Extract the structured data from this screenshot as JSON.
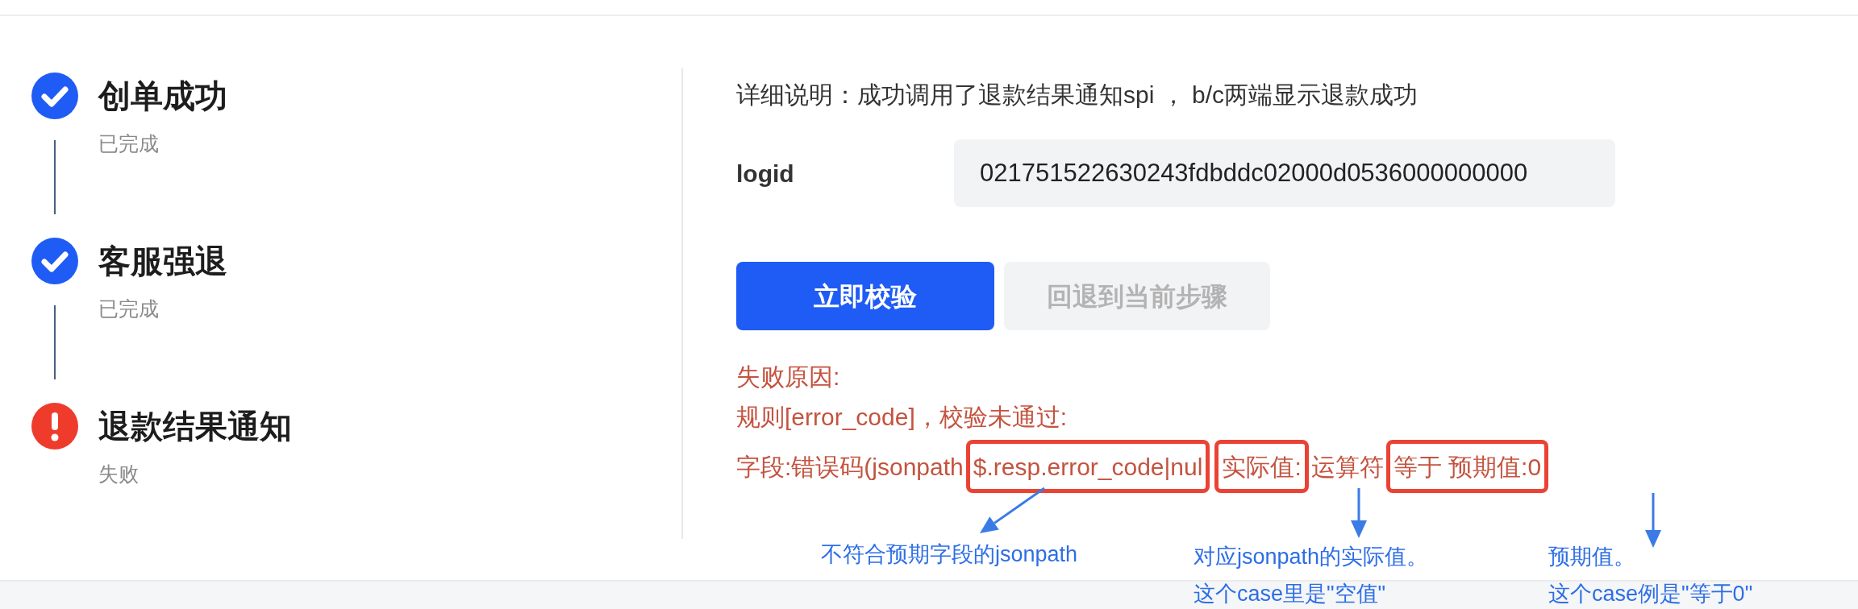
{
  "steps": [
    {
      "title": "创单成功",
      "status_text": "已完成",
      "kind": "done"
    },
    {
      "title": "客服强退",
      "status_text": "已完成",
      "kind": "done"
    },
    {
      "title": "退款结果通知",
      "status_text": "失败",
      "kind": "failed"
    }
  ],
  "detail": "详细说明：成功调用了退款结果通知spi ， b/c两端显示退款成功",
  "logid": {
    "label": "logid",
    "value": "021751522630243fdbddc02000d0536000000000"
  },
  "buttons": [
    {
      "label": "立即校验",
      "disabled": false
    },
    {
      "label": "回退到当前步骤",
      "disabled": true
    }
  ],
  "error_lines": [
    [
      {
        "text": "失败原因:",
        "highlighted": false
      }
    ],
    [
      {
        "text": "规则[error_code]，校验未通过:",
        "highlighted": false
      }
    ],
    [
      {
        "text": "字段:错误码(jsonpath",
        "highlighted": false
      },
      {
        "text": "$.resp.error_code|nul",
        "highlighted": true
      },
      {
        "text": "实际值:",
        "highlighted": true
      },
      {
        "text": "运算符",
        "highlighted": false
      },
      {
        "text": "等于 预期值:0",
        "highlighted": true
      }
    ]
  ],
  "annotations": [
    {
      "lines": [
        "不符合预期字段的jsonpath"
      ]
    },
    {
      "lines": [
        "对应jsonpath的实际值。",
        "这个case里是\"空值\""
      ]
    },
    {
      "lines": [
        "预期值。",
        "这个case例是\"等于0\""
      ]
    }
  ]
}
